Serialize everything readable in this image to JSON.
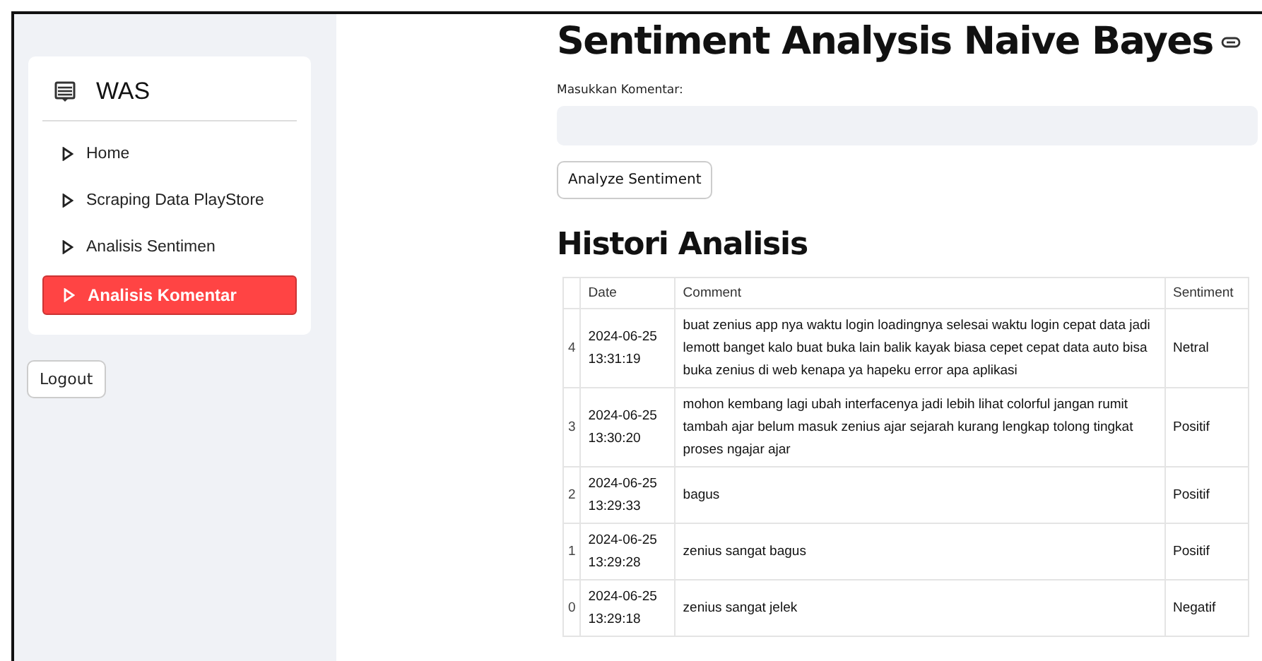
{
  "sidebar": {
    "brand": "WAS",
    "items": [
      {
        "label": "Home",
        "selected": false
      },
      {
        "label": "Scraping Data PlayStore",
        "selected": false
      },
      {
        "label": "Analisis Sentimen",
        "selected": false
      },
      {
        "label": "Analisis Komentar",
        "selected": true
      }
    ],
    "logout": "Logout"
  },
  "main": {
    "title": "Sentiment Analysis Naive Bayes",
    "input_label": "Masukkan Komentar:",
    "button": "Analyze Sentiment",
    "section_title": "Histori Analisis"
  },
  "table": {
    "columns": [
      "Date",
      "Comment",
      "Sentiment"
    ],
    "rows": [
      {
        "index": "4",
        "date": "2024-06-25 13:31:19",
        "comment": "buat zenius app nya waktu login loadingnya selesai waktu login cepat data jadi lemott banget kalo buat buka lain balik kayak biasa cepet cepat data auto bisa buka zenius di web kenapa ya hapeku error apa aplikasi",
        "sentiment": "Netral"
      },
      {
        "index": "3",
        "date": "2024-06-25 13:30:20",
        "comment": "mohon kembang lagi ubah interfacenya jadi lebih lihat colorful jangan rumit tambah ajar belum masuk zenius ajar sejarah kurang lengkap tolong tingkat proses ngajar ajar",
        "sentiment": "Positif"
      },
      {
        "index": "2",
        "date": "2024-06-25 13:29:33",
        "comment": "bagus",
        "sentiment": "Positif"
      },
      {
        "index": "1",
        "date": "2024-06-25 13:29:28",
        "comment": "zenius sangat bagus",
        "sentiment": "Positif"
      },
      {
        "index": "0",
        "date": "2024-06-25 13:29:18",
        "comment": "zenius sangat jelek",
        "sentiment": "Negatif"
      }
    ]
  }
}
